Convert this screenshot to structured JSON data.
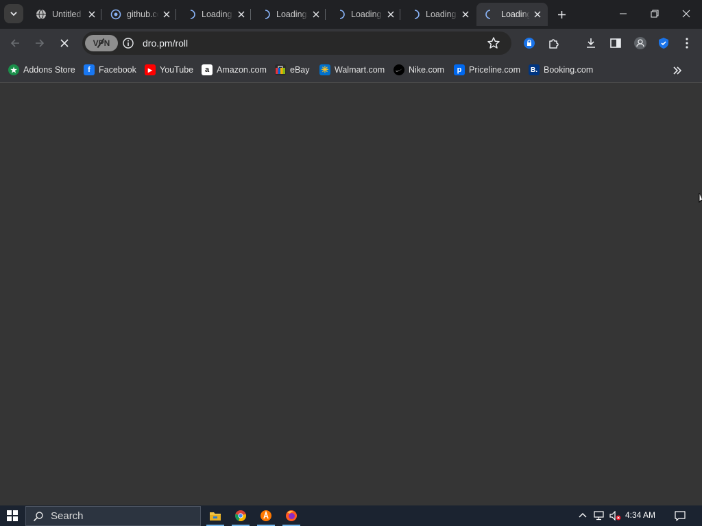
{
  "tabs": [
    {
      "title": "Untitled",
      "icon": "globe-icon",
      "active": false
    },
    {
      "title": "github.com",
      "icon": "github-icon",
      "active": false
    },
    {
      "title": "Loading...",
      "icon": "spinner-icon",
      "active": false
    },
    {
      "title": "Loading...",
      "icon": "spinner-icon",
      "active": false
    },
    {
      "title": "Loading...",
      "icon": "spinner-icon",
      "active": false
    },
    {
      "title": "Loading...",
      "icon": "spinner-icon",
      "active": false
    },
    {
      "title": "Loading...",
      "icon": "spinner-icon",
      "active": true
    }
  ],
  "toolbar": {
    "vpn_label": "VPN",
    "url": "dro.pm/roll"
  },
  "bookmarks": [
    {
      "label": "Addons Store",
      "icon": "addons-store-icon",
      "color": "#1a8f4a"
    },
    {
      "label": "Facebook",
      "icon": "facebook-icon",
      "color": "#1877f2"
    },
    {
      "label": "YouTube",
      "icon": "youtube-icon",
      "color": "#ff0000"
    },
    {
      "label": "Amazon.com",
      "icon": "amazon-icon",
      "color": "#ffffff"
    },
    {
      "label": "eBay",
      "icon": "ebay-icon",
      "color": "#e53238"
    },
    {
      "label": "Walmart.com",
      "icon": "walmart-icon",
      "color": "#0071ce"
    },
    {
      "label": "Nike.com",
      "icon": "nike-icon",
      "color": "#000000"
    },
    {
      "label": "Priceline.com",
      "icon": "priceline-icon",
      "color": "#0068ef"
    },
    {
      "label": "Booking.com",
      "icon": "booking-icon",
      "color": "#003580"
    }
  ],
  "taskbar": {
    "search_label": "Search",
    "time": "4:34 AM",
    "apps": [
      "file-explorer-icon",
      "chrome-icon",
      "avast-icon",
      "firefox-icon"
    ]
  },
  "colors": {
    "tabstrip": "#202124",
    "toolbar": "#35363a",
    "content": "#353535",
    "taskbar": "#1b2330",
    "accent": "#8ab4f8"
  }
}
